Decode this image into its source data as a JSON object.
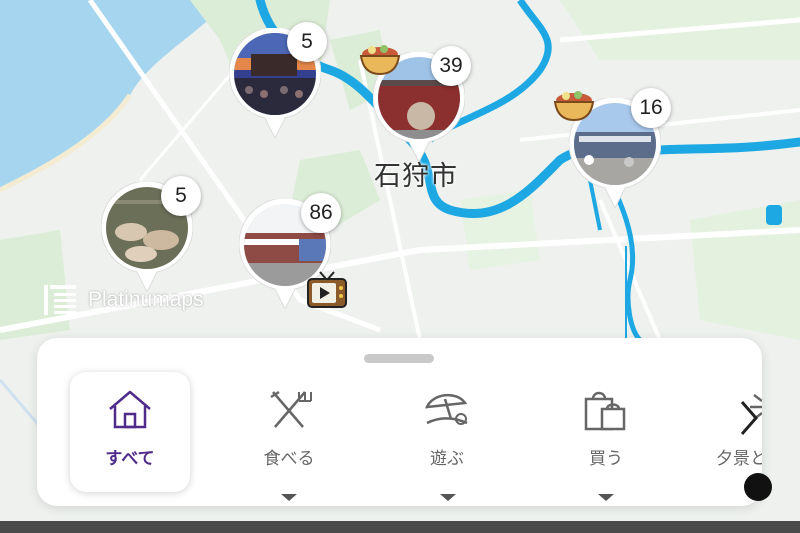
{
  "map": {
    "city_label": "石狩市",
    "brand": "Platinumaps",
    "colors": {
      "sea": "#a6d6ef",
      "land": "#eef1ee",
      "green": "#d7ecd4",
      "river": "#1da8e3",
      "road": "#ffffff"
    }
  },
  "markers": [
    {
      "id": "marker-concert",
      "count": "5",
      "photo": "concert",
      "icon": "none"
    },
    {
      "id": "marker-restaurant",
      "count": "39",
      "photo": "red-building",
      "icon": "food-bowl-icon"
    },
    {
      "id": "marker-market",
      "count": "16",
      "photo": "market-street",
      "icon": "food-bowl-icon"
    },
    {
      "id": "marker-animals",
      "count": "5",
      "photo": "animal-pen",
      "icon": "none"
    },
    {
      "id": "marker-store",
      "count": "86",
      "photo": "store-front",
      "icon": "tv-icon"
    }
  ],
  "panel": {
    "categories": [
      {
        "label": "すべて",
        "icon": "home-icon",
        "active": true
      },
      {
        "label": "食べる",
        "icon": "fork-knife-icon",
        "active": false
      },
      {
        "label": "遊ぶ",
        "icon": "beach-umbrella-icon",
        "active": false
      },
      {
        "label": "買う",
        "icon": "shopping-bag-icon",
        "active": false
      },
      {
        "label": "夕景と",
        "icon": "sunset-icon",
        "active": false
      }
    ],
    "accent": "#4f2c8a"
  }
}
